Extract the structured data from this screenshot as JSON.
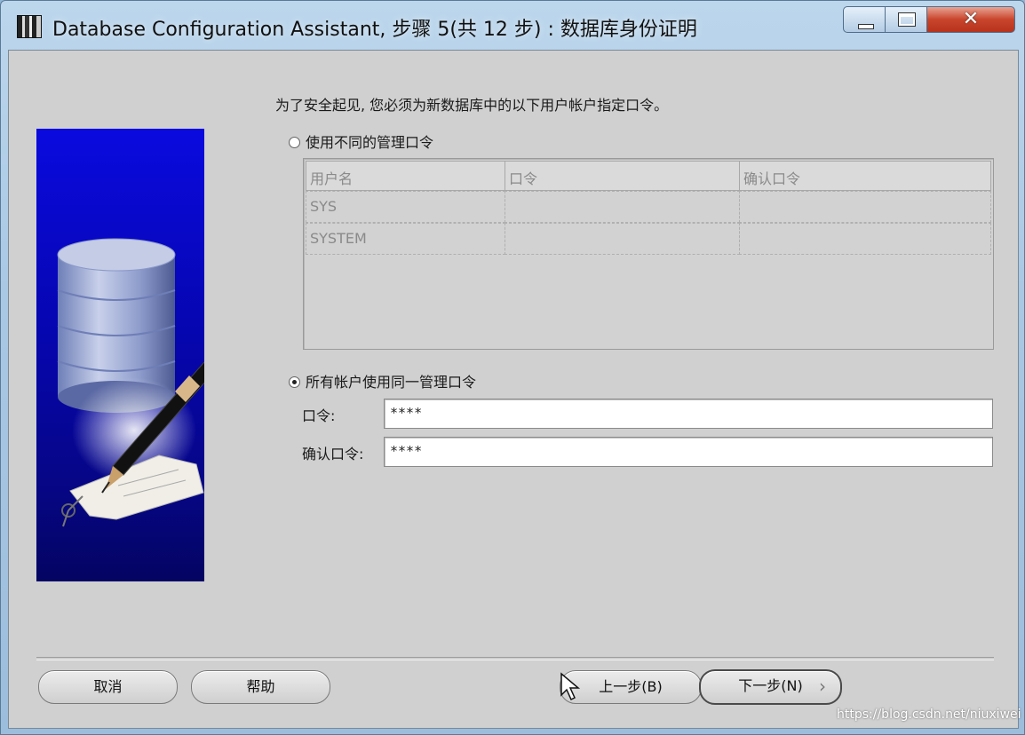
{
  "window": {
    "title": "Database Configuration Assistant, 步骤 5(共 12 步) : 数据库身份证明"
  },
  "content": {
    "intro": "为了安全起见, 您必须为新数据库中的以下用户帐户指定口令。",
    "option_individual": "使用不同的管理口令",
    "option_shared": "所有帐户使用同一管理口令",
    "grid": {
      "columns": [
        "用户名",
        "口令",
        "确认口令"
      ],
      "rows": [
        [
          "SYS",
          "",
          ""
        ],
        [
          "SYSTEM",
          "",
          ""
        ]
      ]
    },
    "password_label": "口令:",
    "password_value": "****",
    "confirm_label": "确认口令:",
    "confirm_value": "****"
  },
  "footer": {
    "cancel": "取消",
    "help": "帮助",
    "back": "上一步(B)",
    "next": "下一步(N)"
  },
  "watermark": "https://blog.csdn.net/niuxiwei",
  "colors": {
    "dialog_bg": "#d0d0d0",
    "banner_blue": "#0606b0",
    "close_red": "#c9452c"
  }
}
